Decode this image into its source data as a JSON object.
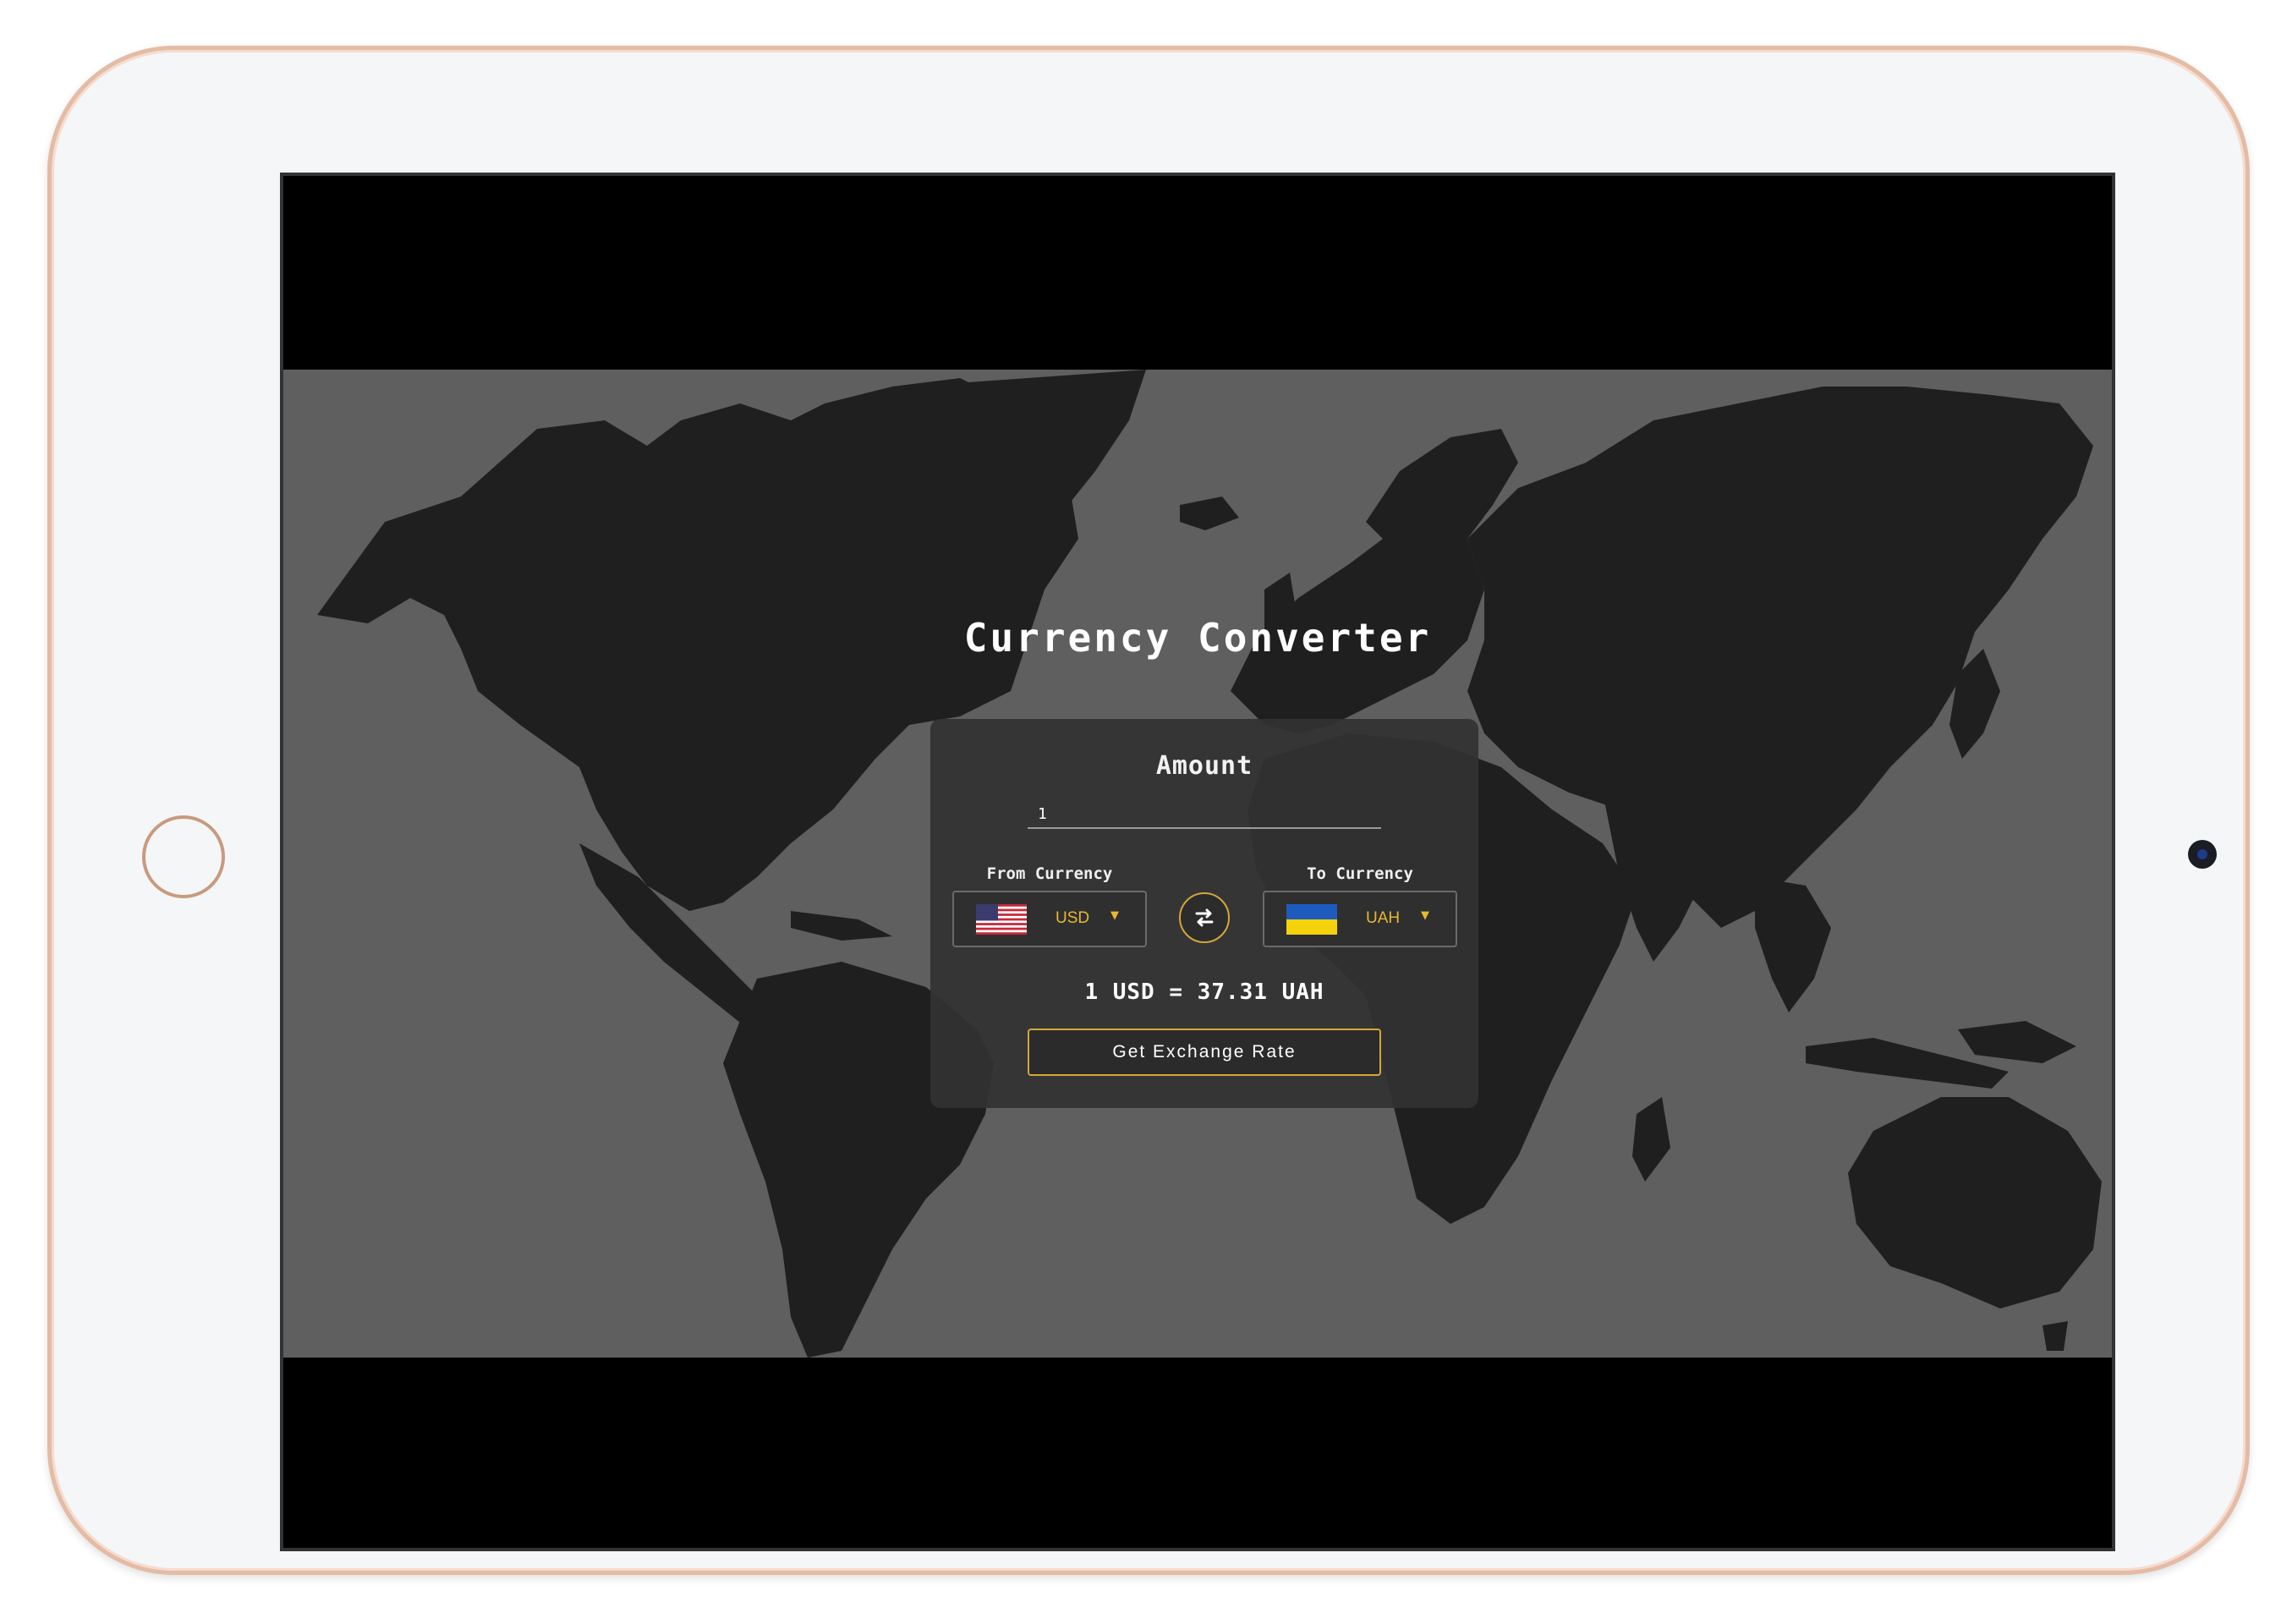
{
  "app": {
    "title": "Currency Converter"
  },
  "converter": {
    "amount_label": "Amount",
    "amount_value": "1",
    "from": {
      "label": "From Currency",
      "code": "USD",
      "flag": "us-flag-icon"
    },
    "to": {
      "label": "To Currency",
      "code": "UAH",
      "flag": "ua-flag-icon"
    },
    "result": "1 USD = 37.31 UAH",
    "button_label": "Get Exchange Rate",
    "caret": "▼"
  },
  "colors": {
    "accent": "#e7b932",
    "map_background": "#5f5f5f",
    "land": "#1f1f1f",
    "card": "#323232",
    "tablet_frame": "#e4bba5"
  }
}
